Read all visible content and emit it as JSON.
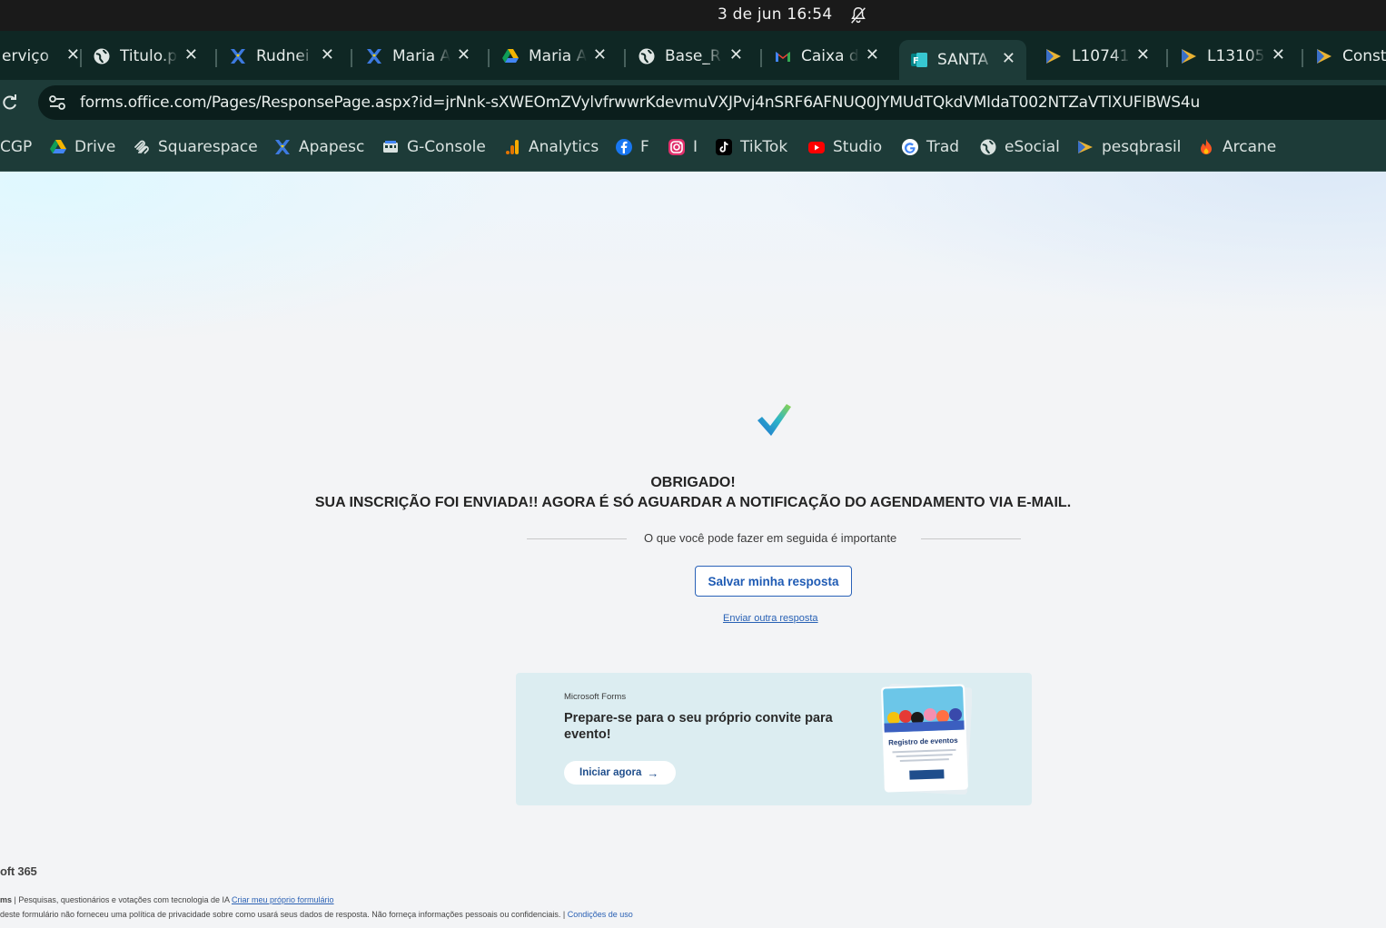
{
  "os": {
    "clock": "3 de jun  16:54"
  },
  "tabs": [
    {
      "title": "erviço",
      "icon": "doc-icon"
    },
    {
      "title": "Titulo.p",
      "icon": "globe-icon"
    },
    {
      "title": "Rudnei",
      "icon": "apapesc-icon"
    },
    {
      "title": "Maria A",
      "icon": "apapesc-icon"
    },
    {
      "title": "Maria A",
      "icon": "drive-icon"
    },
    {
      "title": "Base_R",
      "icon": "globe-icon"
    },
    {
      "title": "Caixa d",
      "icon": "gmail-icon"
    },
    {
      "title": "SANTA",
      "icon": "forms-icon",
      "active": true
    },
    {
      "title": "L10741",
      "icon": "pesq-icon"
    },
    {
      "title": "L13105",
      "icon": "pesq-icon"
    },
    {
      "title": "Const",
      "icon": "pesq-icon"
    }
  ],
  "address": {
    "url": "forms.office.com/Pages/ResponsePage.aspx?id=jrNnk-sXWEOmZVylvfrwwrKdevmuVXJPvj4nSRF6AFNUQ0JYMUdTQkdVMldaT002NTZaVTlXUFlBWS4u"
  },
  "bookmarks": [
    {
      "label": "CGP",
      "icon": ""
    },
    {
      "label": "Drive",
      "icon": "drive-icon"
    },
    {
      "label": "Squarespace",
      "icon": "squarespace-icon"
    },
    {
      "label": "Apapesc",
      "icon": "apapesc-icon"
    },
    {
      "label": "G-Console",
      "icon": "console-icon"
    },
    {
      "label": "Analytics",
      "icon": "analytics-icon"
    },
    {
      "label": "F",
      "icon": "facebook-icon"
    },
    {
      "label": "I",
      "icon": "instagram-icon"
    },
    {
      "label": "TikTok",
      "icon": "tiktok-icon"
    },
    {
      "label": "Studio",
      "icon": "youtube-icon"
    },
    {
      "label": "Trad",
      "icon": "google-icon"
    },
    {
      "label": "eSocial",
      "icon": "globe-icon"
    },
    {
      "label": "pesqbrasil",
      "icon": "pesq-icon"
    },
    {
      "label": "Arcane",
      "icon": "fire-icon"
    }
  ],
  "confirmation": {
    "title": "OBRIGADO!",
    "message": "SUA INSCRIÇÃO FOI ENVIADA!! AGORA É SÓ AGUARDAR A NOTIFICAÇÃO DO AGENDAMENTO VIA E-MAIL.",
    "next_steps": "O que você pode fazer em seguida é importante",
    "save_button": "Salvar minha resposta",
    "another_link": "Enviar outra resposta"
  },
  "promo": {
    "brand": "Microsoft Forms",
    "headline": "Prepare-se para o seu próprio convite para evento!",
    "cta": "Iniciar agora",
    "card_title": "Registro de eventos"
  },
  "footer": {
    "brand": "oft 365",
    "line1_prefix": "ms",
    "line1_text": " | Pesquisas, questionários e votações com tecnologia de IA ",
    "line1_link": "Criar meu próprio formulário",
    "line2_text": "deste formulário não forneceu uma política de privacidade sobre como usará seus dados de resposta. Não forneça informações pessoais ou confidenciais. | ",
    "line2_link": "Condições de uso"
  },
  "colors": {
    "accent_blue": "#2a62b8",
    "tab_bg": "#0f2724",
    "toolbar_bg": "#1d3b38"
  }
}
